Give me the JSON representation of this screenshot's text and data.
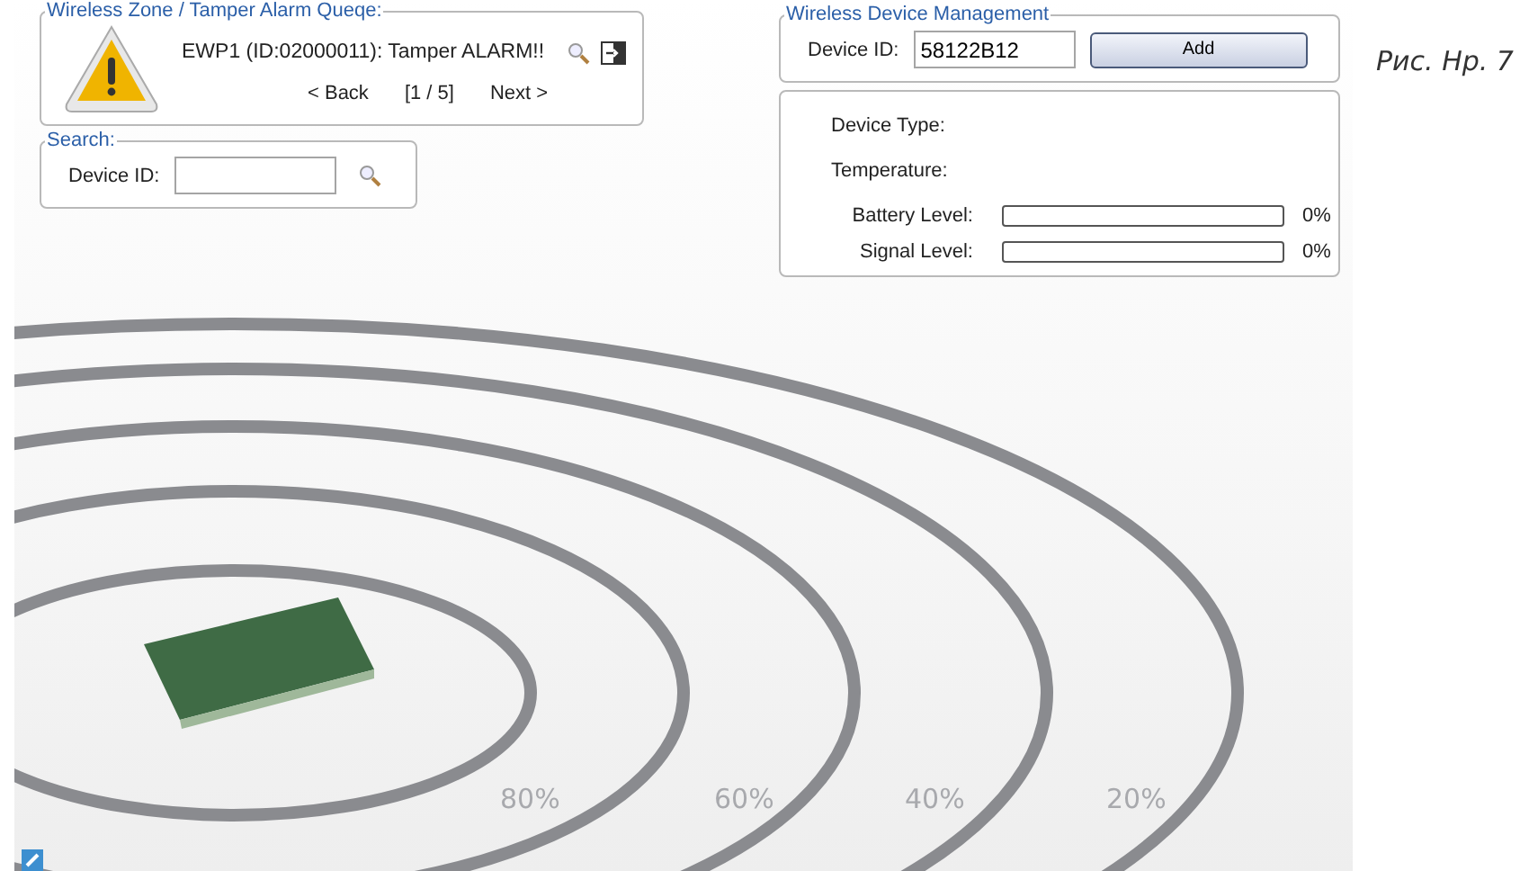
{
  "alarm_queue": {
    "legend": "Wireless Zone / Tamper Alarm Queqe:",
    "message": "EWP1 (ID:02000011): Tamper ALARM!!",
    "back": "< Back",
    "position": "[1 / 5]",
    "next": "Next >"
  },
  "search": {
    "legend": "Search:",
    "label": "Device ID:"
  },
  "device_management": {
    "legend": "Wireless Device Management",
    "label": "Device ID:",
    "value": "58122B12",
    "add_button": "Add"
  },
  "device_info": {
    "fields": [
      {
        "kind": "text",
        "label": "Device Type:"
      },
      {
        "kind": "text",
        "label": "Temperature:"
      },
      {
        "kind": "meter",
        "label": "Battery Level:",
        "level": 0,
        "reading": "0%"
      },
      {
        "kind": "meter",
        "label": "Signal Level:",
        "level": 0,
        "reading": "0%"
      }
    ]
  },
  "range_rings": [
    "80%",
    "60%",
    "40%",
    "20%"
  ],
  "caption": "Рис. Нр. 7"
}
